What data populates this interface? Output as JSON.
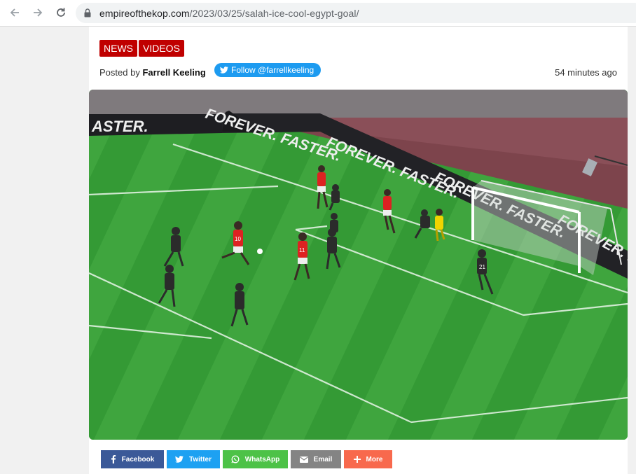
{
  "browser": {
    "url_domain": "empireofthekop.com",
    "url_path": "/2023/03/25/salah-ice-cool-egypt-goal/"
  },
  "article": {
    "tags": [
      "NEWS",
      "VIDEOS"
    ],
    "posted_by_prefix": "Posted by",
    "author": "Farrell Keeling",
    "follow_label": "Follow @farrellkeeling",
    "time_ago": "54 minutes ago"
  },
  "pitch": {
    "board_text": "FOREVER. FASTER.",
    "board_text_left": "ASTER.",
    "jersey_numbers": [
      "10",
      "11",
      "21"
    ]
  },
  "share": [
    {
      "label": "Facebook",
      "icon": "facebook-icon",
      "color": "#3b5998"
    },
    {
      "label": "Twitter",
      "icon": "twitter-icon",
      "color": "#1da1f2"
    },
    {
      "label": "WhatsApp",
      "icon": "whatsapp-icon",
      "color": "#4dc247"
    },
    {
      "label": "Email",
      "icon": "email-icon",
      "color": "#848484"
    },
    {
      "label": "More",
      "icon": "plus-icon",
      "color": "#f8694d"
    }
  ],
  "colors": {
    "tag_red": "#c00000",
    "twitter_blue": "#1d9bf0",
    "pitch_green": "#3a9d3a"
  }
}
